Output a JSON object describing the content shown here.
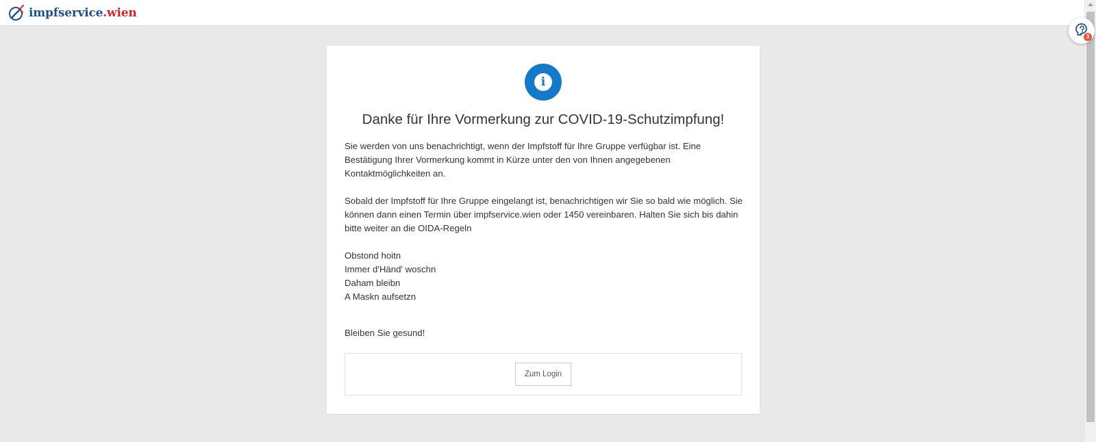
{
  "header": {
    "logo_part1": "impfservice",
    "logo_part2": ".wien",
    "logo_icon": "syringe-circle-icon"
  },
  "accessibility_widget": {
    "icon": "accessibility-head-icon",
    "badge": "3"
  },
  "card": {
    "status_icon": "info-icon",
    "status_glyph": "i",
    "title": "Danke für Ihre Vormerkung zur COVID-19-Schutzimpfung!",
    "paragraphs": [
      "Sie werden von uns benachrichtigt, wenn der Impfstoff für Ihre Gruppe verfügbar ist. Eine Bestätigung Ihrer Vormerkung kommt in Kürze unter den von Ihnen angegebenen Kontaktmöglichkeiten an.",
      "Sobald der Impfstoff für Ihre Gruppe eingelangt ist, benachrichtigen wir Sie so bald wie möglich. Sie können dann einen Termin über impfservice.wien oder 1450 vereinbaren. Halten Sie sich bis dahin bitte weiter an die OIDA-Regeln"
    ],
    "rules": [
      "Obstond hoitn",
      "Immer d'Händ' woschn",
      "Daham bleibn",
      "A Maskn aufsetzn"
    ],
    "closing": "Bleiben Sie gesund!",
    "login_button": "Zum Login"
  },
  "colors": {
    "brand_blue": "#1c4f8e",
    "brand_red": "#d3232a",
    "info_blue": "#1479c9",
    "background": "#e9e9e9"
  }
}
